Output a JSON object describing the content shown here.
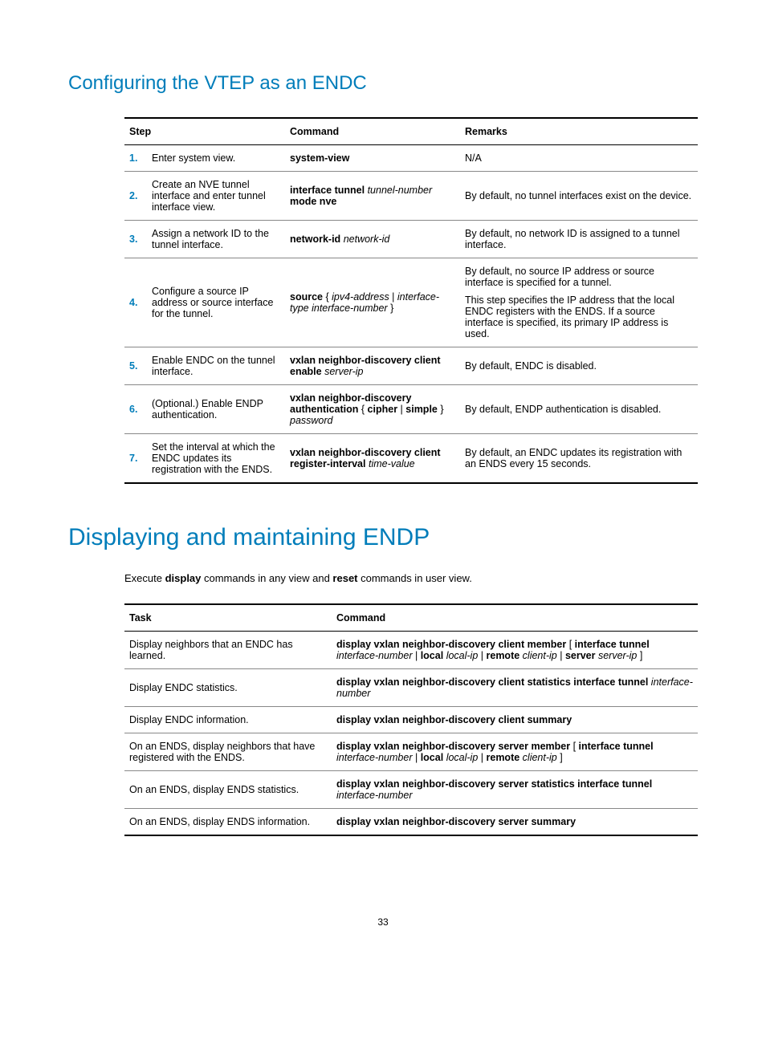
{
  "h2": "Configuring the VTEP as an ENDC",
  "table1": {
    "headers": {
      "step": "Step",
      "command": "Command",
      "remarks": "Remarks"
    },
    "rows": [
      {
        "num": "1.",
        "step": "Enter system view.",
        "cmd": [
          {
            "b": "system-view"
          }
        ],
        "rem": [
          "N/A"
        ]
      },
      {
        "num": "2.",
        "step": "Create an NVE tunnel interface and enter tunnel interface view.",
        "cmd": [
          {
            "b": "interface tunnel"
          },
          {
            "t": " "
          },
          {
            "i": "tunnel-number"
          },
          {
            "br": true
          },
          {
            "b": "mode nve"
          }
        ],
        "rem": [
          "By default, no tunnel interfaces exist on the device."
        ]
      },
      {
        "num": "3.",
        "step": "Assign a network ID to the tunnel interface.",
        "cmd": [
          {
            "b": "network-id"
          },
          {
            "t": " "
          },
          {
            "i": "network-id"
          }
        ],
        "rem": [
          "By default, no network ID is assigned to a tunnel interface."
        ]
      },
      {
        "num": "4.",
        "step": "Configure a source IP address or source interface for the tunnel.",
        "cmd": [
          {
            "b": "source"
          },
          {
            "t": " { "
          },
          {
            "i": "ipv4-address"
          },
          {
            "t": " | "
          },
          {
            "i": "interface-type interface-number"
          },
          {
            "t": " }"
          }
        ],
        "rem": [
          "By default, no source IP address or source interface is specified for a tunnel.",
          "This step specifies the IP address that the local ENDC registers with the ENDS. If a source interface is specified, its primary IP address is used."
        ]
      },
      {
        "num": "5.",
        "step": "Enable ENDC on the tunnel interface.",
        "cmd": [
          {
            "b": "vxlan neighbor-discovery client enable"
          },
          {
            "t": " "
          },
          {
            "i": "server-ip"
          }
        ],
        "rem": [
          "By default, ENDC is disabled."
        ]
      },
      {
        "num": "6.",
        "step": "(Optional.) Enable ENDP authentication.",
        "cmd": [
          {
            "b": "vxlan neighbor-discovery authentication"
          },
          {
            "t": " { "
          },
          {
            "b": "cipher"
          },
          {
            "t": " | "
          },
          {
            "b": "simple"
          },
          {
            "t": " } "
          },
          {
            "i": "password"
          }
        ],
        "rem": [
          "By default, ENDP authentication is disabled."
        ]
      },
      {
        "num": "7.",
        "step": "Set the interval at which the ENDC updates its registration with the ENDS.",
        "cmd": [
          {
            "b": "vxlan neighbor-discovery client register-interval"
          },
          {
            "t": " "
          },
          {
            "i": "time-value"
          }
        ],
        "rem": [
          "By default, an ENDC updates its registration with an ENDS every 15 seconds."
        ]
      }
    ]
  },
  "h1": "Displaying and maintaining ENDP",
  "intro": {
    "pre": "Execute ",
    "b1": "display",
    "mid": " commands in any view and ",
    "b2": "reset",
    "post": " commands in user view."
  },
  "table2": {
    "headers": {
      "task": "Task",
      "command": "Command"
    },
    "rows": [
      {
        "task": "Display neighbors that an ENDC has learned.",
        "cmd": [
          {
            "b": "display vxlan neighbor-discovery client member"
          },
          {
            "t": " [ "
          },
          {
            "b": "interface tunnel"
          },
          {
            "t": " "
          },
          {
            "i": "interface-number"
          },
          {
            "t": " | "
          },
          {
            "b": "local"
          },
          {
            "t": " "
          },
          {
            "i": "local-ip"
          },
          {
            "t": " | "
          },
          {
            "b": "remote"
          },
          {
            "t": " "
          },
          {
            "i": "client-ip"
          },
          {
            "t": " | "
          },
          {
            "b": "server"
          },
          {
            "t": " "
          },
          {
            "i": "server-ip"
          },
          {
            "t": " ]"
          }
        ]
      },
      {
        "task": "Display ENDC statistics.",
        "cmd": [
          {
            "b": "display vxlan neighbor-discovery client statistics interface tunnel"
          },
          {
            "t": " "
          },
          {
            "i": "interface-number"
          }
        ]
      },
      {
        "task": "Display ENDC information.",
        "cmd": [
          {
            "b": "display vxlan neighbor-discovery client summary"
          }
        ]
      },
      {
        "task": "On an ENDS, display neighbors that have registered with the ENDS.",
        "cmd": [
          {
            "b": "display vxlan neighbor-discovery server member"
          },
          {
            "t": " [ "
          },
          {
            "b": "interface tunnel"
          },
          {
            "t": " "
          },
          {
            "i": "interface-number"
          },
          {
            "t": " | "
          },
          {
            "b": "local"
          },
          {
            "t": " "
          },
          {
            "i": "local-ip"
          },
          {
            "t": " | "
          },
          {
            "b": "remote"
          },
          {
            "t": " "
          },
          {
            "i": "client-ip"
          },
          {
            "t": " ]"
          }
        ]
      },
      {
        "task": "On an ENDS, display ENDS statistics.",
        "cmd": [
          {
            "b": "display vxlan neighbor-discovery server statistics interface tunnel"
          },
          {
            "t": " "
          },
          {
            "i": "interface-number"
          }
        ]
      },
      {
        "task": "On an ENDS, display ENDS information.",
        "cmd": [
          {
            "b": "display vxlan neighbor-discovery server summary"
          }
        ]
      }
    ]
  },
  "pagenum": "33"
}
